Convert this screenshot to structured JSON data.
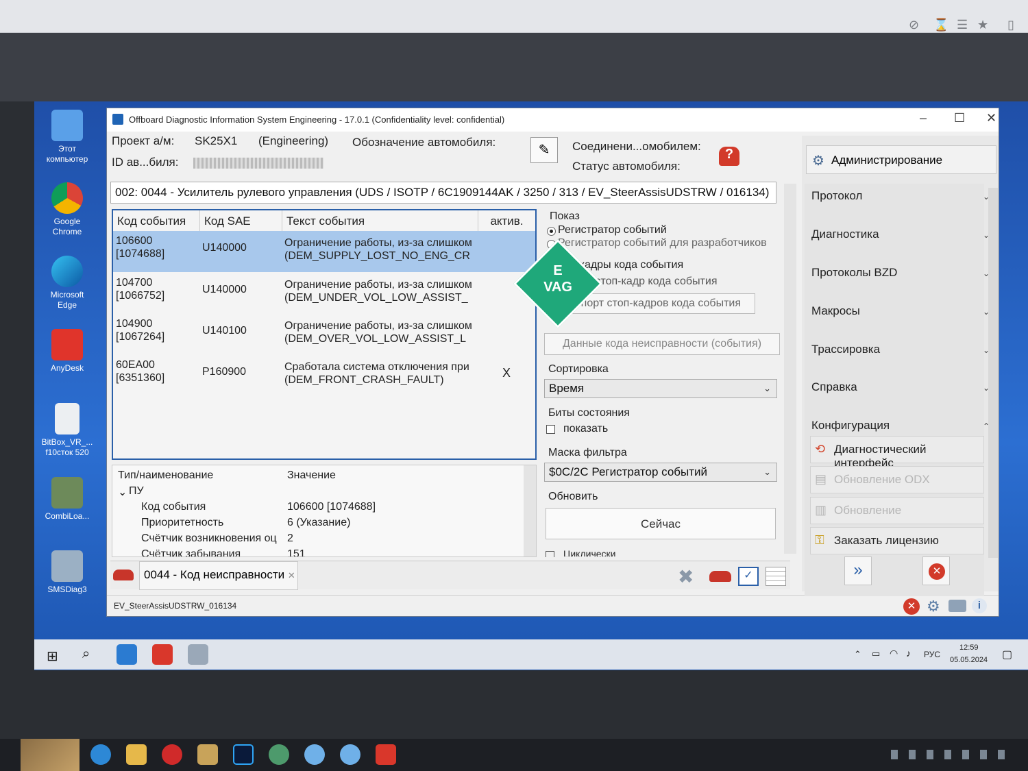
{
  "window": {
    "title": "Offboard Diagnostic Information System Engineering - 17.0.1 (Confidentiality level: confidential)"
  },
  "header": {
    "project_label": "Проект а/м:",
    "project_value": "SK25X1",
    "project_mode": "(Engineering)",
    "vehicle_designation_label": "Обозначение автомобиля:",
    "vin_label": "ID ав...биля:",
    "connection_label": "Соединени...омобилем:",
    "vehicle_status_label": "Статус автомобиля:"
  },
  "ecu_title": "002: 0044 - Усилитель рулевого управления  (UDS / ISOTP / 6C1909144AK / 3250 / 313 / EV_SteerAssisUDSTRW / 016134)",
  "events_table": {
    "columns": [
      "Код события",
      "Код SAE",
      "Текст события",
      "актив."
    ],
    "rows": [
      {
        "code": "106600",
        "code2": "[1074688]",
        "sae": "U140000",
        "text1": "Ограничение работы, из-за слишком",
        "text2": "(DEM_SUPPLY_LOST_NO_ENG_CR",
        "active": ""
      },
      {
        "code": "104700",
        "code2": "[1066752]",
        "sae": "U140000",
        "text1": "Ограничение работы, из-за слишком",
        "text2": "(DEM_UNDER_VOL_LOW_ASSIST_",
        "active": ""
      },
      {
        "code": "104900",
        "code2": "[1067264]",
        "sae": "U140100",
        "text1": "Ограничение работы, из-за слишком",
        "text2": "(DEM_OVER_VOL_LOW_ASSIST_L",
        "active": ""
      },
      {
        "code": "60EA00",
        "code2": "[6351360]",
        "sae": "P160900",
        "text1": "Сработала система отключения при",
        "text2": "(DEM_FRONT_CRASH_FAULT)",
        "active": "X"
      }
    ]
  },
  "details": {
    "col_name": "Тип/наименование",
    "col_value": "Значение",
    "group": "ПУ",
    "items": [
      {
        "name": "Код события",
        "value": "106600 [1074688]"
      },
      {
        "name": "Приоритетность",
        "value": "6 (Указание)"
      },
      {
        "name": "Счётчик возникновения оц",
        "value": "2"
      },
      {
        "name": "Счётчик забывания",
        "value": "151"
      }
    ]
  },
  "display": {
    "label": "Показ",
    "radio_1": "Регистратор событий",
    "radio_2": "Регистратор событий для разработчиков",
    "freeze_label": "Стоп-кадры кода события",
    "read_freeze": "Считать стоп-кадр кода события",
    "export_freeze": "Экспорт стоп-кадров кода события",
    "fault_data_btn": "Данные кода неисправности (события)",
    "sort_label": "Сортировка",
    "sort_value": "Время",
    "status_bits_label": "Биты состояния",
    "show_checkbox": "показать",
    "filter_label": "Маска фильтра",
    "filter_value": "$0C/2C Регистратор событий",
    "refresh_label": "Обновить",
    "now_btn": "Сейчас",
    "cyclic": "Циклически"
  },
  "bottom_tab": "0044 - Код неисправности",
  "status_bar": "EV_SteerAssisUDSTRW_016134",
  "sidenav": {
    "admin": "Администрирование",
    "sections": [
      "Протокол",
      "Диагностика",
      "Протоколы BZD",
      "Макросы",
      "Трассировка",
      "Справка",
      "Конфигурация"
    ],
    "config_items": [
      "Диагностический интерфейс",
      "Обновление ODX",
      "Обновление",
      "Заказать лицензию"
    ]
  },
  "desktop_icons": [
    "Этот компьютер",
    "Google Chrome",
    "Microsoft Edge",
    "AnyDesk",
    "BitBox_VR_... f10сток 520",
    "CombiLoa...",
    "SMSDiag3"
  ],
  "taskbar": {
    "lang": "РУС",
    "time": "12:59",
    "date": "05.05.2024"
  },
  "watermark": {
    "line1": "E",
    "line2": "VAG"
  },
  "colors": {
    "selection": "#a8c8ec",
    "table_border": "#2a5fa8",
    "desktop": "#2c6fd2"
  }
}
